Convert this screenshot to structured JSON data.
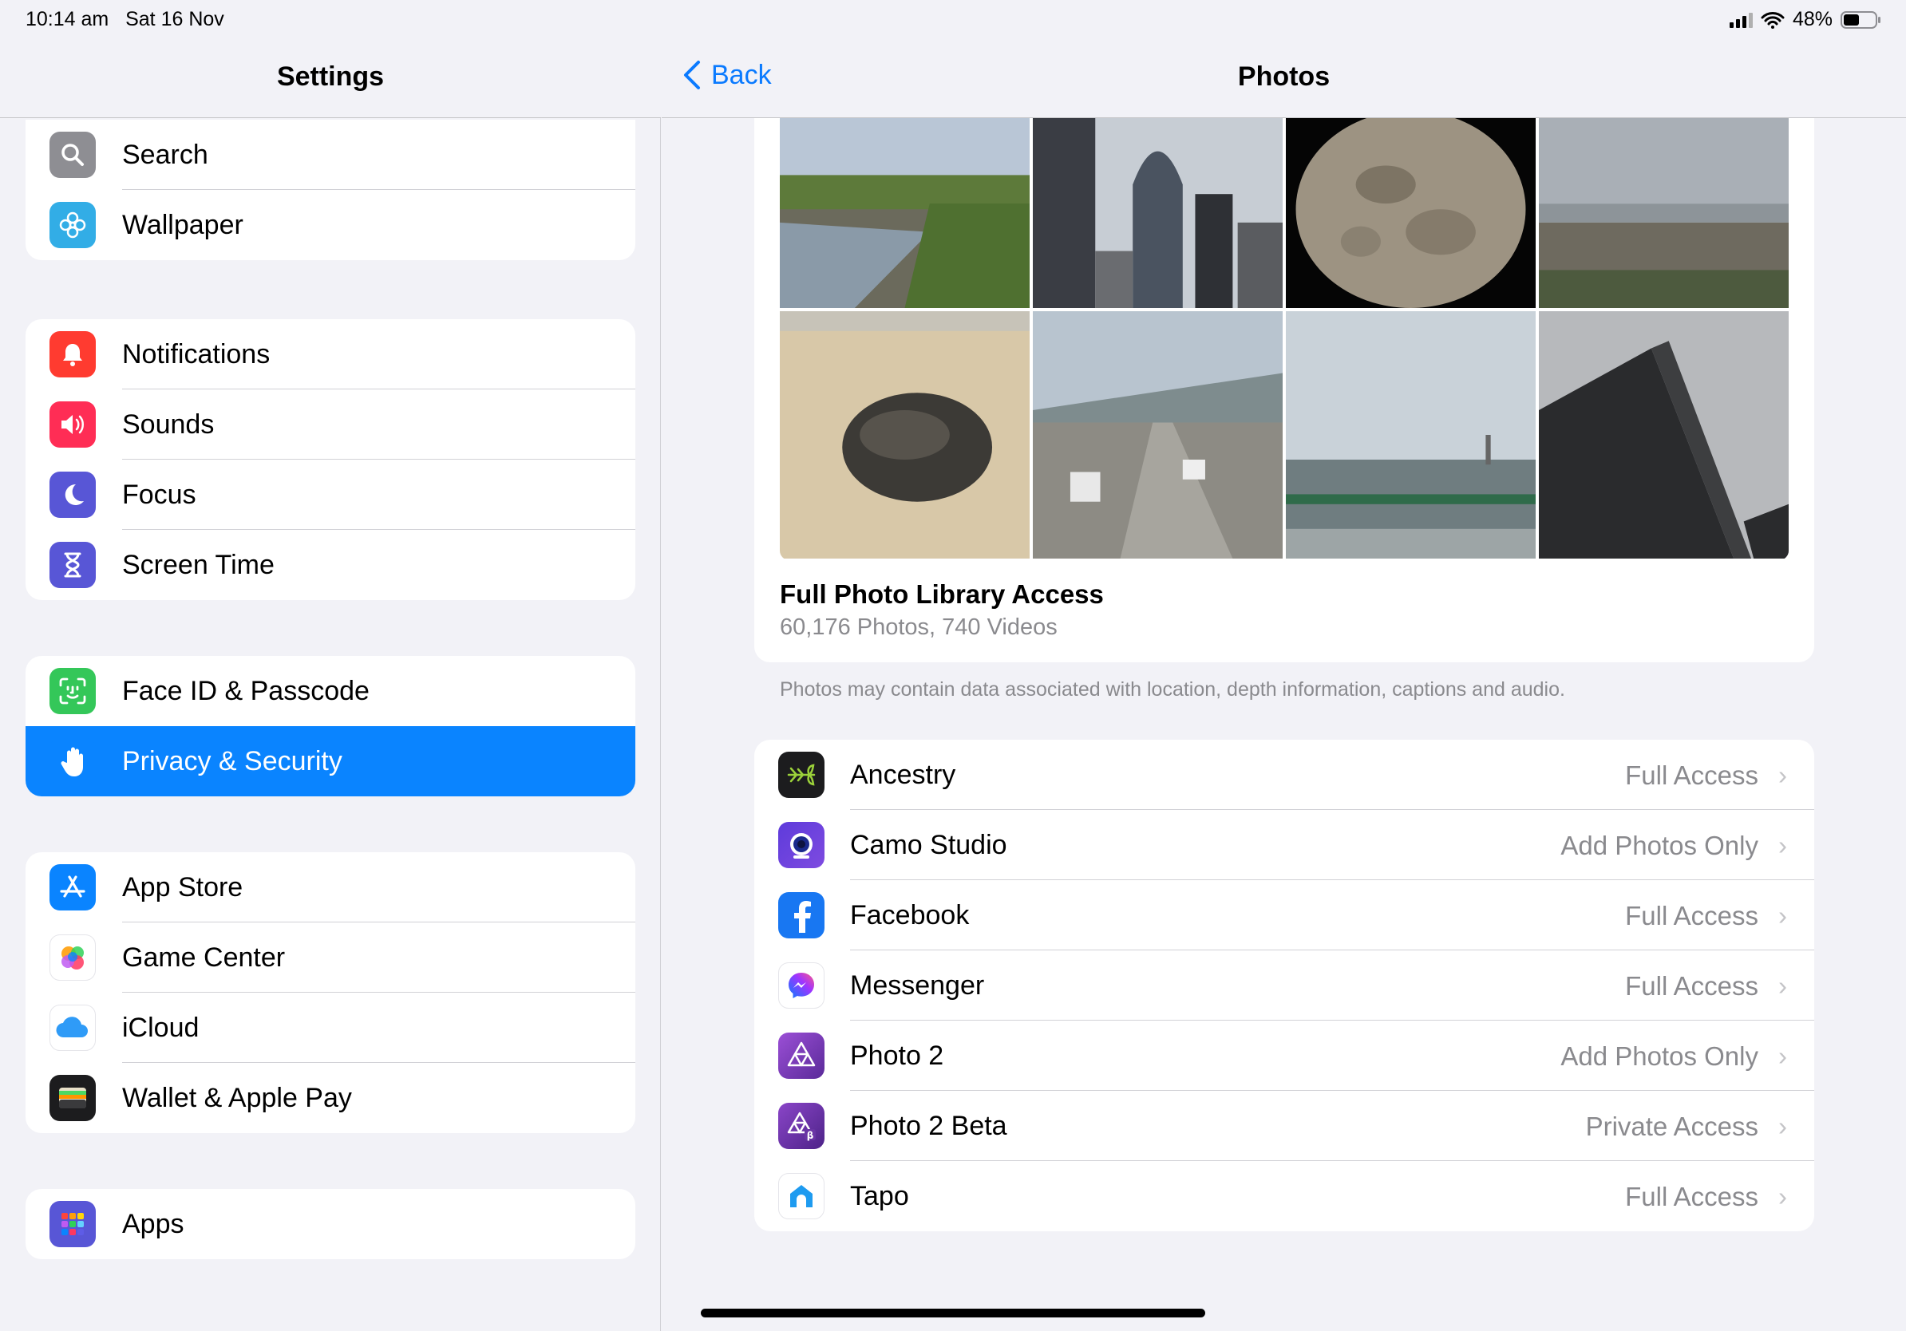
{
  "status_bar": {
    "time": "10:14 am",
    "date": "Sat 16 Nov",
    "battery": "48%"
  },
  "sidebar": {
    "title": "Settings",
    "groups": [
      {
        "items": [
          {
            "label": "Search",
            "icon": "search-icon",
            "color": "#8e8e93"
          },
          {
            "label": "Wallpaper",
            "icon": "flower-icon",
            "color": "#32ade6"
          }
        ]
      },
      {
        "items": [
          {
            "label": "Notifications",
            "icon": "bell-icon",
            "color": "#ff3b30"
          },
          {
            "label": "Sounds",
            "icon": "speaker-icon",
            "color": "#ff2d55"
          },
          {
            "label": "Focus",
            "icon": "moon-icon",
            "color": "#5856d6"
          },
          {
            "label": "Screen Time",
            "icon": "hourglass-icon",
            "color": "#5856d6"
          }
        ]
      },
      {
        "items": [
          {
            "label": "Face ID & Passcode",
            "icon": "faceid-icon",
            "color": "#34c759"
          },
          {
            "label": "Privacy & Security",
            "icon": "hand-icon",
            "color": "#0a84ff",
            "selected": true
          }
        ]
      },
      {
        "items": [
          {
            "label": "App Store",
            "icon": "appstore-icon",
            "color": "#0a84ff"
          },
          {
            "label": "Game Center",
            "icon": "gamecenter-icon",
            "color": "#ffffff"
          },
          {
            "label": "iCloud",
            "icon": "cloud-icon",
            "color": "#ffffff"
          },
          {
            "label": "Wallet & Apple Pay",
            "icon": "wallet-icon",
            "color": "#1c1c1e"
          }
        ]
      },
      {
        "items": [
          {
            "label": "Apps",
            "icon": "apps-grid-icon",
            "color": "#5856d6"
          }
        ]
      }
    ]
  },
  "detail": {
    "back_label": "Back",
    "title": "Photos",
    "library": {
      "title": "Full Photo Library Access",
      "subtitle": "60,176 Photos, 740 Videos"
    },
    "footnote": "Photos may contain data associated with location, depth information, captions and audio.",
    "apps": [
      {
        "name": "Ancestry",
        "access": "Full Access",
        "icon": "ancestry-leaf-icon",
        "color": "#1c1c1e"
      },
      {
        "name": "Camo Studio",
        "access": "Add Photos Only",
        "icon": "camo-lens-icon",
        "color": "#5e3bdb"
      },
      {
        "name": "Facebook",
        "access": "Full Access",
        "icon": "facebook-icon",
        "color": "#1877f2"
      },
      {
        "name": "Messenger",
        "access": "Full Access",
        "icon": "messenger-icon",
        "color": "#ffffff"
      },
      {
        "name": "Photo 2",
        "access": "Add Photos Only",
        "icon": "affinity-photo-icon",
        "color": "#7b3fb8"
      },
      {
        "name": "Photo 2 Beta",
        "access": "Private Access",
        "icon": "affinity-photo-beta-icon",
        "color": "#6a35a5"
      },
      {
        "name": "Tapo",
        "access": "Full Access",
        "icon": "tapo-house-icon",
        "color": "#ffffff"
      }
    ]
  },
  "colors": {
    "accent": "#0a84ff",
    "background": "#f2f2f7",
    "secondary_text": "#8a8a8e"
  }
}
